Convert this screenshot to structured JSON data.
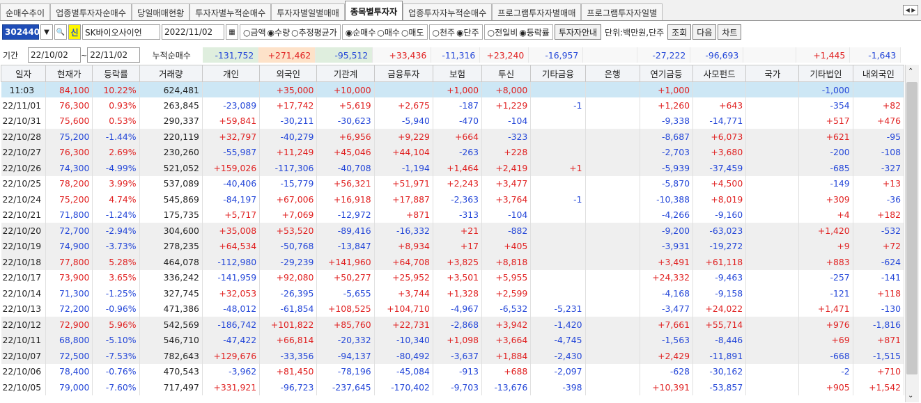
{
  "tabs": [
    "순매수추이",
    "업종별투자자순매수",
    "당일매매현황",
    "투자자별누적순매수",
    "투자자별일별매매",
    "종목별투자자",
    "업종투자자누적순매수",
    "프로그램투자자별매매",
    "프로그램투자자일별"
  ],
  "active_tab": 5,
  "toolbar": {
    "code": "302440",
    "stock_name": "SK바이오사이언",
    "date": "2022/11/02",
    "radio_amount": "○금액",
    "radio_qty": "◉수량",
    "radio_avg": "○추정평균가",
    "radio_net": "◉순매수",
    "radio_buy": "○매수",
    "radio_sell": "○매도",
    "radio_thousand": "○천주",
    "radio_unit": "◉단주",
    "radio_prev": "○전일비",
    "radio_rate": "◉등락률",
    "investor_btn": "투자자안내",
    "unit_text": "단위:백만원,단주",
    "query_btn": "조회",
    "next_btn": "다음",
    "chart_btn": "차트"
  },
  "period": {
    "label": "기간",
    "from": "22/10/02",
    "to": "22/11/02",
    "cumulative_label": "누적순매수"
  },
  "summary": [
    "-131,752",
    "+271,462",
    "-95,512",
    "+33,436",
    "-11,316",
    "+23,240",
    "-16,957",
    "",
    "-27,222",
    "-96,693",
    "",
    "+1,445",
    "-1,643"
  ],
  "headers": [
    "일자",
    "현재가",
    "등락률",
    "거래량",
    "개인",
    "외국인",
    "기관계",
    "금융투자",
    "보험",
    "투신",
    "기타금융",
    "은행",
    "연기금등",
    "사모펀드",
    "국가",
    "기타법인",
    "내외국인"
  ],
  "rows": [
    [
      "11:03",
      "84,100",
      "10.22%",
      "624,481",
      "",
      "+35,000",
      "+10,000",
      "",
      "+1,000",
      "+8,000",
      "",
      "",
      "+1,000",
      "",
      "",
      "-1,000",
      ""
    ],
    [
      "22/11/01",
      "76,300",
      "0.93%",
      "263,845",
      "-23,089",
      "+17,742",
      "+5,619",
      "+2,675",
      "-187",
      "+1,229",
      "-1",
      "",
      "+1,260",
      "+643",
      "",
      "-354",
      "+82"
    ],
    [
      "22/10/31",
      "75,600",
      "0.53%",
      "290,337",
      "+59,841",
      "-30,211",
      "-30,623",
      "-5,940",
      "-470",
      "-104",
      "",
      "",
      "-9,338",
      "-14,771",
      "",
      "+517",
      "+476"
    ],
    [
      "22/10/28",
      "75,200",
      "-1.44%",
      "220,119",
      "+32,797",
      "-40,279",
      "+6,956",
      "+9,229",
      "+664",
      "-323",
      "",
      "",
      "-8,687",
      "+6,073",
      "",
      "+621",
      "-95"
    ],
    [
      "22/10/27",
      "76,300",
      "2.69%",
      "230,260",
      "-55,987",
      "+11,249",
      "+45,046",
      "+44,104",
      "-263",
      "+228",
      "",
      "",
      "-2,703",
      "+3,680",
      "",
      "-200",
      "-108"
    ],
    [
      "22/10/26",
      "74,300",
      "-4.99%",
      "521,052",
      "+159,026",
      "-117,306",
      "-40,708",
      "-1,194",
      "+1,464",
      "+2,419",
      "+1",
      "",
      "-5,939",
      "-37,459",
      "",
      "-685",
      "-327"
    ],
    [
      "22/10/25",
      "78,200",
      "3.99%",
      "537,089",
      "-40,406",
      "-15,779",
      "+56,321",
      "+51,971",
      "+2,243",
      "+3,477",
      "",
      "",
      "-5,870",
      "+4,500",
      "",
      "-149",
      "+13"
    ],
    [
      "22/10/24",
      "75,200",
      "4.74%",
      "545,869",
      "-84,197",
      "+67,006",
      "+16,918",
      "+17,887",
      "-2,363",
      "+3,764",
      "-1",
      "",
      "-10,388",
      "+8,019",
      "",
      "+309",
      "-36"
    ],
    [
      "22/10/21",
      "71,800",
      "-1.24%",
      "175,735",
      "+5,717",
      "+7,069",
      "-12,972",
      "+871",
      "-313",
      "-104",
      "",
      "",
      "-4,266",
      "-9,160",
      "",
      "+4",
      "+182"
    ],
    [
      "22/10/20",
      "72,700",
      "-2.94%",
      "304,600",
      "+35,008",
      "+53,520",
      "-89,416",
      "-16,332",
      "+21",
      "-882",
      "",
      "",
      "-9,200",
      "-63,023",
      "",
      "+1,420",
      "-532"
    ],
    [
      "22/10/19",
      "74,900",
      "-3.73%",
      "278,235",
      "+64,534",
      "-50,768",
      "-13,847",
      "+8,934",
      "+17",
      "+405",
      "",
      "",
      "-3,931",
      "-19,272",
      "",
      "+9",
      "+72"
    ],
    [
      "22/10/18",
      "77,800",
      "5.28%",
      "464,078",
      "-112,980",
      "-29,239",
      "+141,960",
      "+64,708",
      "+3,825",
      "+8,818",
      "",
      "",
      "+3,491",
      "+61,118",
      "",
      "+883",
      "-624"
    ],
    [
      "22/10/17",
      "73,900",
      "3.65%",
      "336,242",
      "-141,959",
      "+92,080",
      "+50,277",
      "+25,952",
      "+3,501",
      "+5,955",
      "",
      "",
      "+24,332",
      "-9,463",
      "",
      "-257",
      "-141"
    ],
    [
      "22/10/14",
      "71,300",
      "-1.25%",
      "327,745",
      "+32,053",
      "-26,395",
      "-5,655",
      "+3,744",
      "+1,328",
      "+2,599",
      "",
      "",
      "-4,168",
      "-9,158",
      "",
      "-121",
      "+118"
    ],
    [
      "22/10/13",
      "72,200",
      "-0.96%",
      "471,386",
      "-48,012",
      "-61,854",
      "+108,525",
      "+104,710",
      "-4,967",
      "-6,532",
      "-5,231",
      "",
      "-3,477",
      "+24,022",
      "",
      "+1,471",
      "-130"
    ],
    [
      "22/10/12",
      "72,900",
      "5.96%",
      "542,569",
      "-186,742",
      "+101,822",
      "+85,760",
      "+22,731",
      "-2,868",
      "+3,942",
      "-1,420",
      "",
      "+7,661",
      "+55,714",
      "",
      "+976",
      "-1,816"
    ],
    [
      "22/10/11",
      "68,800",
      "-5.10%",
      "546,710",
      "-47,422",
      "+66,814",
      "-20,332",
      "-10,340",
      "+1,098",
      "+3,664",
      "-4,745",
      "",
      "-1,563",
      "-8,446",
      "",
      "+69",
      "+871"
    ],
    [
      "22/10/07",
      "72,500",
      "-7.53%",
      "782,643",
      "+129,676",
      "-33,356",
      "-94,137",
      "-80,492",
      "-3,637",
      "+1,884",
      "-2,430",
      "",
      "+2,429",
      "-11,891",
      "",
      "-668",
      "-1,515"
    ],
    [
      "22/10/06",
      "78,400",
      "-0.76%",
      "470,543",
      "-3,962",
      "+81,450",
      "-78,196",
      "-45,084",
      "-913",
      "+688",
      "-2,097",
      "",
      "-628",
      "-30,162",
      "",
      "-2",
      "+710"
    ],
    [
      "22/10/05",
      "79,000",
      "-7.60%",
      "717,497",
      "+331,921",
      "-96,723",
      "-237,645",
      "-170,402",
      "-9,703",
      "-13,676",
      "-398",
      "",
      "+10,391",
      "-53,857",
      "",
      "+905",
      "+1,542"
    ]
  ]
}
